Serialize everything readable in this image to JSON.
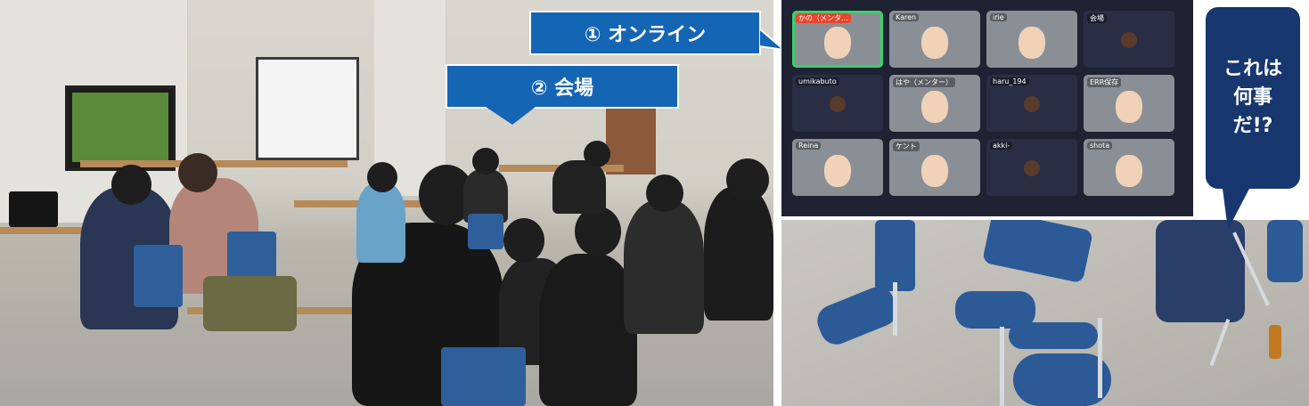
{
  "callouts": {
    "online": "① オンライン",
    "venue": "② 会場",
    "question_lines": [
      "これは",
      "何事",
      "だ!?"
    ]
  },
  "zoom_tiles": [
    {
      "label": "かの（メンタ...",
      "video": true,
      "speaking": true
    },
    {
      "label": "Karen",
      "video": true,
      "speaking": false
    },
    {
      "label": "irie",
      "video": true,
      "speaking": false
    },
    {
      "label": "会場",
      "video": false,
      "speaking": false
    },
    {
      "label": "umikabuto",
      "video": false,
      "speaking": false
    },
    {
      "label": "はや（メンター）",
      "video": true,
      "speaking": false
    },
    {
      "label": "haru_194",
      "video": false,
      "speaking": false
    },
    {
      "label": "ERR保存",
      "video": true,
      "speaking": false
    },
    {
      "label": "Reina",
      "video": true,
      "speaking": false
    },
    {
      "label": "ケント",
      "video": true,
      "speaking": false
    },
    {
      "label": "akki-",
      "video": false,
      "speaking": false
    },
    {
      "label": "shota",
      "video": true,
      "speaking": false
    }
  ],
  "colors": {
    "callout_blue": "#1565b5",
    "question_navy": "#17376e",
    "zoom_bg": "#1f2233",
    "chair_blue": "#2c5a96"
  }
}
